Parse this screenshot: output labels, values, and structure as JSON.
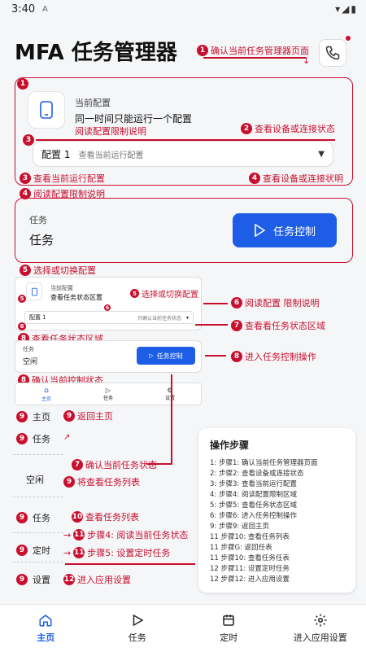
{
  "status": {
    "time": "3:40",
    "notif": "A"
  },
  "header": {
    "title": "MFA 任务管理器"
  },
  "annotations": {
    "a1": "确认当前任务管理器页面",
    "a2": "查看设备或连接状态",
    "a3": "查看当前运行配置",
    "a4": "查看设备或连接状明",
    "a4b": "阅读配置限制说明",
    "a5": "选择或切换配置",
    "a5b": "选择或切换配置",
    "a6": "阅读配置 限制说明",
    "a7": "查看看任务状态区域",
    "a7b": "确认当前任务状态",
    "a8": "进入任务控制操作",
    "a8b": "查看任务状态区域",
    "a8c": "确认当前控制状态",
    "a9a": "返回主页",
    "a9b": "将查看任务列表",
    "a10": "查看任务列表",
    "a11a": "步骤4: 阅读当前任务状态",
    "a11b": "步骤5: 设置定时任务",
    "a12": "进入应用设置",
    "config_limit": "阅读配置限制说明"
  },
  "config_card": {
    "label": "当前配置",
    "desc": "同一时间只能运行一个配置",
    "select_value": "配置 1",
    "select_placeholder": "查看当前运行配置"
  },
  "task_card": {
    "label": "任务",
    "status": "任务",
    "button": "任务控制"
  },
  "mini": {
    "config_label": "当前配置",
    "config_desc": "查看任务状态区置",
    "select_value": "配置 1",
    "select_placeholder": "只确认当前任务状态",
    "task_label": "任务",
    "task_status": "空闲",
    "button": "任务控制",
    "nav": [
      "主页",
      "任务",
      "设置"
    ]
  },
  "left_list": [
    "主页",
    "任务",
    "空闲",
    "任务",
    "定时",
    "设置"
  ],
  "steps": {
    "title": "操作步骤",
    "items": [
      "1: 步骤1: 确认当前任务管理器页面",
      "2: 步骤2: 查看设备或连接状态",
      "3: 步骤3: 查看当前运行配置",
      "4: 步骤4: 阅读配置限制区域",
      "5: 步骤5: 查看任务状态区域",
      "6: 步骤6: 进入任务控制操作",
      "9: 步骤9: 返回主页",
      "11 步骤10: 查看任务列表",
      "11 步骤G: 返回任表",
      "11 步骤10: 查看任务任表",
      "12 步骤11: 设置定时任务",
      "12 步骤12: 进入应用设置"
    ]
  },
  "bottom_nav": [
    "主页",
    "任务",
    "定时",
    "进入应用设置"
  ],
  "colors": {
    "accent": "#1e5ee6",
    "annotation": "#c8102e"
  }
}
